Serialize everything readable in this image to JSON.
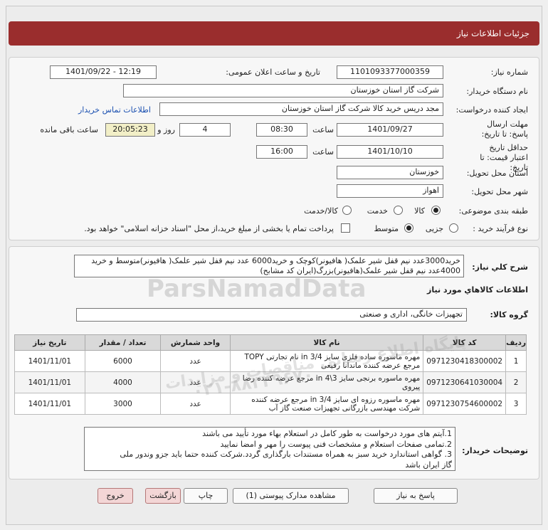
{
  "header": {
    "title": "جزئیات اطلاعات نیاز"
  },
  "form": {
    "need_number_label": "شماره نیاز:",
    "need_number": "1101093377000359",
    "announce_label": "تاریخ و ساعت اعلان عمومی:",
    "announce_value": "1401/09/22 - 12:19",
    "buyer_org_label": "نام دستگاه خریدار:",
    "buyer_org": "شرکت گاز استان خوزستان",
    "creator_label": "ایجاد کننده درخواست:",
    "creator": "مجد دریس خرید کالا شرکت گاز استان خوزستان",
    "contact_link": "اطلاعات تماس خریدار",
    "send_deadline_label": "مهلت ارسال پاسخ: تا تاریخ:",
    "send_date": "1401/09/27",
    "hour_label": "ساعت",
    "send_time": "08:30",
    "days_value": "4",
    "days_label": "روز و",
    "remaining_time": "20:05:23",
    "remaining_label": "ساعت باقی مانده",
    "validity_label": "حداقل تاریخ اعتبار قیمت: تا تاریخ:",
    "validity_date": "1401/10/10",
    "validity_hour_label": "ساعت",
    "validity_time": "16:00",
    "province_label": "استان محل تحویل:",
    "province": "خوزستان",
    "city_label": "شهر محل تحویل:",
    "city": "اهواز",
    "category_label": "طبقه بندی موضوعی:",
    "category_options": [
      "کالا",
      "خدمت",
      "کالا/خدمت"
    ],
    "process_label": "نوع فرآیند خرید :",
    "process_options": [
      "جزیی",
      "متوسط"
    ],
    "payment_note": "پرداخت تمام یا بخشی از مبلغ خرید،از محل \"اسناد خزانه اسلامی\" خواهد بود."
  },
  "description": {
    "label": "شرح کلي نياز:",
    "text": "خرید3000عدد نیم قفل شیر علمک( هافیونر)کوچک و خرید6000 عدد نیم قفل شیر علمک( هافیونر)متوسط و خرید 4000عدد نیم قفل شیر علمک(هافیونر)بزرگ(ایران کد مشابح)"
  },
  "goods": {
    "section_title": "اطلاعات کالاهاي مورد نياز",
    "group_label": "گروه کالا:",
    "group_value": "تجهیزات خانگی، اداری و صنعتی",
    "columns": [
      "ردیف",
      "کد کالا",
      "نام کالا",
      "واحد شمارش",
      "تعداد / مقدار",
      "تاریخ نیاز"
    ],
    "rows": [
      {
        "index": "1",
        "code": "0971230418300002",
        "name": "مهره ماسوره ساده فلزی سایز 3/4 in نام تجارتی TOPY مرجع عرضه کننده ماندانا رفیعی",
        "unit": "عدد",
        "qty": "6000",
        "date": "1401/11/01"
      },
      {
        "index": "2",
        "code": "0971230641030004",
        "name": "مهره ماسوره برنجی سایز 3\\4 in مرجع عرضه کننده رضا پیروی",
        "unit": "عدد",
        "qty": "4000",
        "date": "1401/11/01"
      },
      {
        "index": "3",
        "code": "0971230754600002",
        "name": "مهره ماسوره رزوه ای سایز 3/4 in مرجع عرضه کننده شرکت مهندسی بازرگانی تجهیزات صنعت گاز آب",
        "unit": "عدد",
        "qty": "3000",
        "date": "1401/11/01"
      }
    ]
  },
  "notes": {
    "label": "توضیحات خریدار:",
    "lines": [
      "1.آیتم های مورد درخواست به طور کامل در استعلام بهاء مورد تأیید می باشند",
      "2.تمامی صفحات استعلام و مشخصات فنی پیوست را مهر و امضا نمایید",
      "3. گواهی استاندارد خرید سبز به همراه مستندات بارگذاری گردد.شرکت کننده حتما باید جزو وندور ملی",
      "گاز ایران باشد"
    ]
  },
  "buttons": {
    "reply": "پاسخ به نیاز",
    "attachments": "مشاهده مدارک پیوستی (1)",
    "print": "چاپ",
    "back": "بازگشت",
    "exit": "خروج"
  },
  "watermark": {
    "brand": "ParsNamadData",
    "tagline": "پایگاه اطلاع رسانی مناقصات و مزایدات",
    "phone": "۰۲۱-۸۸۳۴۹۶۷۰"
  },
  "colors": {
    "header": "#9a2d2d",
    "link": "#1a4fb0",
    "pink_button": "#f3d6d6",
    "remaining_bg": "#f2efc7"
  }
}
